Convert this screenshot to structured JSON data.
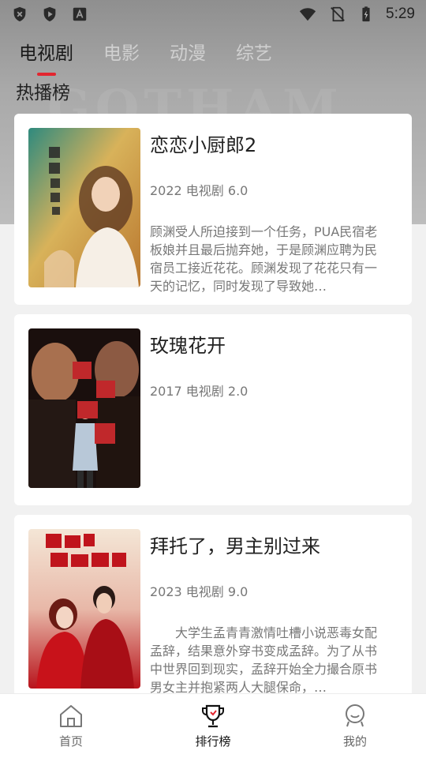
{
  "status": {
    "time": "5:29"
  },
  "tabs": [
    {
      "label": "电视剧",
      "active": true
    },
    {
      "label": "电影",
      "active": false
    },
    {
      "label": "动漫",
      "active": false
    },
    {
      "label": "综艺",
      "active": false
    }
  ],
  "section_title": "热播榜",
  "cards": [
    {
      "title": "恋恋小厨郎2",
      "meta": "2022 电视剧 6.0",
      "description": "顾渊受人所迫接到一个任务，PUA民宿老板娘并且最后抛弃她，于是顾渊应聘为民宿员工接近花花。顾渊发现了花花只有一天的记忆，同时发现了导致她…",
      "poster_caption": "恋恋小厨郎2"
    },
    {
      "title": "玫瑰花开",
      "meta": "2017 电视剧 2.0",
      "description": "",
      "poster_caption": "玫瑰花开"
    },
    {
      "title": "拜托了，男主别过来",
      "meta": "2023 电视剧 9.0",
      "description": "大学生孟青青激情吐槽小说恶毒女配孟辞，结果意外穿书变成孟辞。为了从书中世界回到现实，孟辞开始全力撮合原书男女主并抱紧两人大腿保命，…",
      "poster_caption": "拜托了，男主别过来"
    }
  ],
  "bottom_nav": [
    {
      "label": "首页",
      "icon": "home-icon",
      "active": false
    },
    {
      "label": "排行榜",
      "icon": "trophy-icon",
      "active": true
    },
    {
      "label": "我的",
      "icon": "profile-icon",
      "active": false
    }
  ],
  "colors": {
    "accent": "#e3262f",
    "background": "#f1f1f1"
  }
}
